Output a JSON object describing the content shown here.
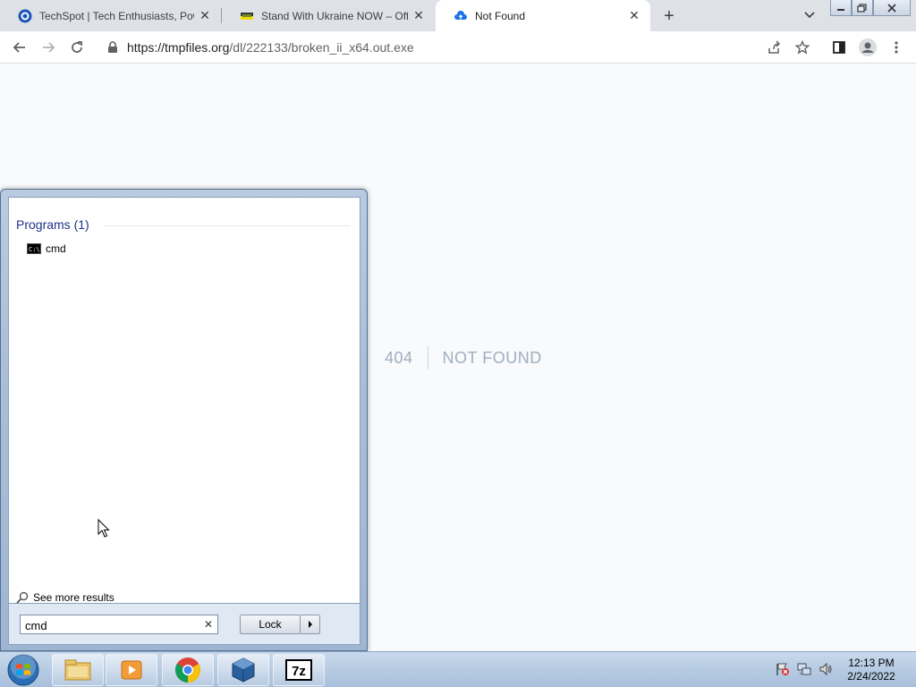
{
  "browser": {
    "tabs": [
      {
        "title": "TechSpot | Tech Enthusiasts, Pow",
        "favicon": "techspot-icon",
        "active": false
      },
      {
        "title": "Stand With Ukraine NOW – Offic",
        "favicon": "ukraine-icon",
        "active": false
      },
      {
        "title": "Not Found",
        "favicon": "cloud-upload-icon",
        "active": true
      }
    ],
    "address_bar": {
      "url": "https://tmpfiles.org/dl/222133/broken_ii_x64.out.exe"
    }
  },
  "page": {
    "error_code": "404",
    "error_message": "NOT FOUND"
  },
  "start_menu": {
    "group_label": "Programs (1)",
    "results": [
      {
        "label": "cmd",
        "icon": "cmd-icon"
      }
    ],
    "see_more": "See more results",
    "search_value": "cmd",
    "lock_label": "Lock"
  },
  "taskbar": {
    "apps": [
      "file-explorer-icon",
      "media-player-icon",
      "chrome-icon",
      "virtualbox-icon",
      "7zip-icon"
    ],
    "clock": {
      "time": "12:13 PM",
      "date": "2/24/2022"
    }
  }
}
